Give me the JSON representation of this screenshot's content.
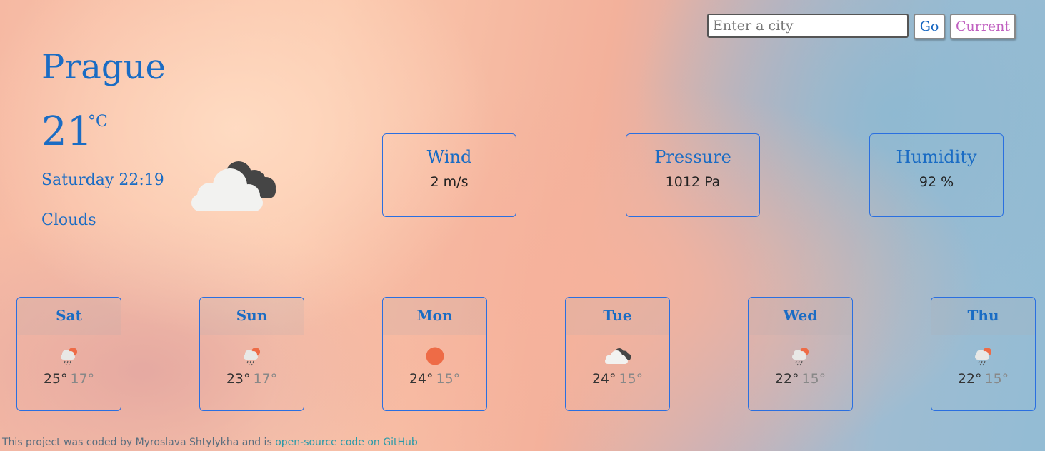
{
  "search": {
    "placeholder": "Enter a city",
    "go_label": "Go",
    "current_label": "Current"
  },
  "current": {
    "city": "Prague",
    "temperature": "21",
    "unit": "°C",
    "datetime": "Saturday 22:19",
    "description": "Clouds",
    "icon": "cloudy-icon"
  },
  "stats": [
    {
      "label": "Wind",
      "value": "2 m/s"
    },
    {
      "label": "Pressure",
      "value": "1012 Pa"
    },
    {
      "label": "Humidity",
      "value": "92 %"
    }
  ],
  "forecast": [
    {
      "day": "Sat",
      "high": "25°",
      "low": "17°",
      "icon": "rain-sun-icon"
    },
    {
      "day": "Sun",
      "high": "23°",
      "low": "17°",
      "icon": "rain-sun-icon"
    },
    {
      "day": "Mon",
      "high": "24°",
      "low": "15°",
      "icon": "sun-icon"
    },
    {
      "day": "Tue",
      "high": "24°",
      "low": "15°",
      "icon": "cloudy-icon"
    },
    {
      "day": "Wed",
      "high": "22°",
      "low": "15°",
      "icon": "rain-sun-icon"
    },
    {
      "day": "Thu",
      "high": "22°",
      "low": "15°",
      "icon": "rain-sun-icon"
    }
  ],
  "footer": {
    "text": "This project was coded by Myroslava Shtylykha and is ",
    "link_text": "open-source code on GitHub"
  },
  "colors": {
    "accent": "#1a6cc4",
    "border": "#2a6fe0",
    "current_button": "#c060c0",
    "sun": "#ee6b46"
  }
}
